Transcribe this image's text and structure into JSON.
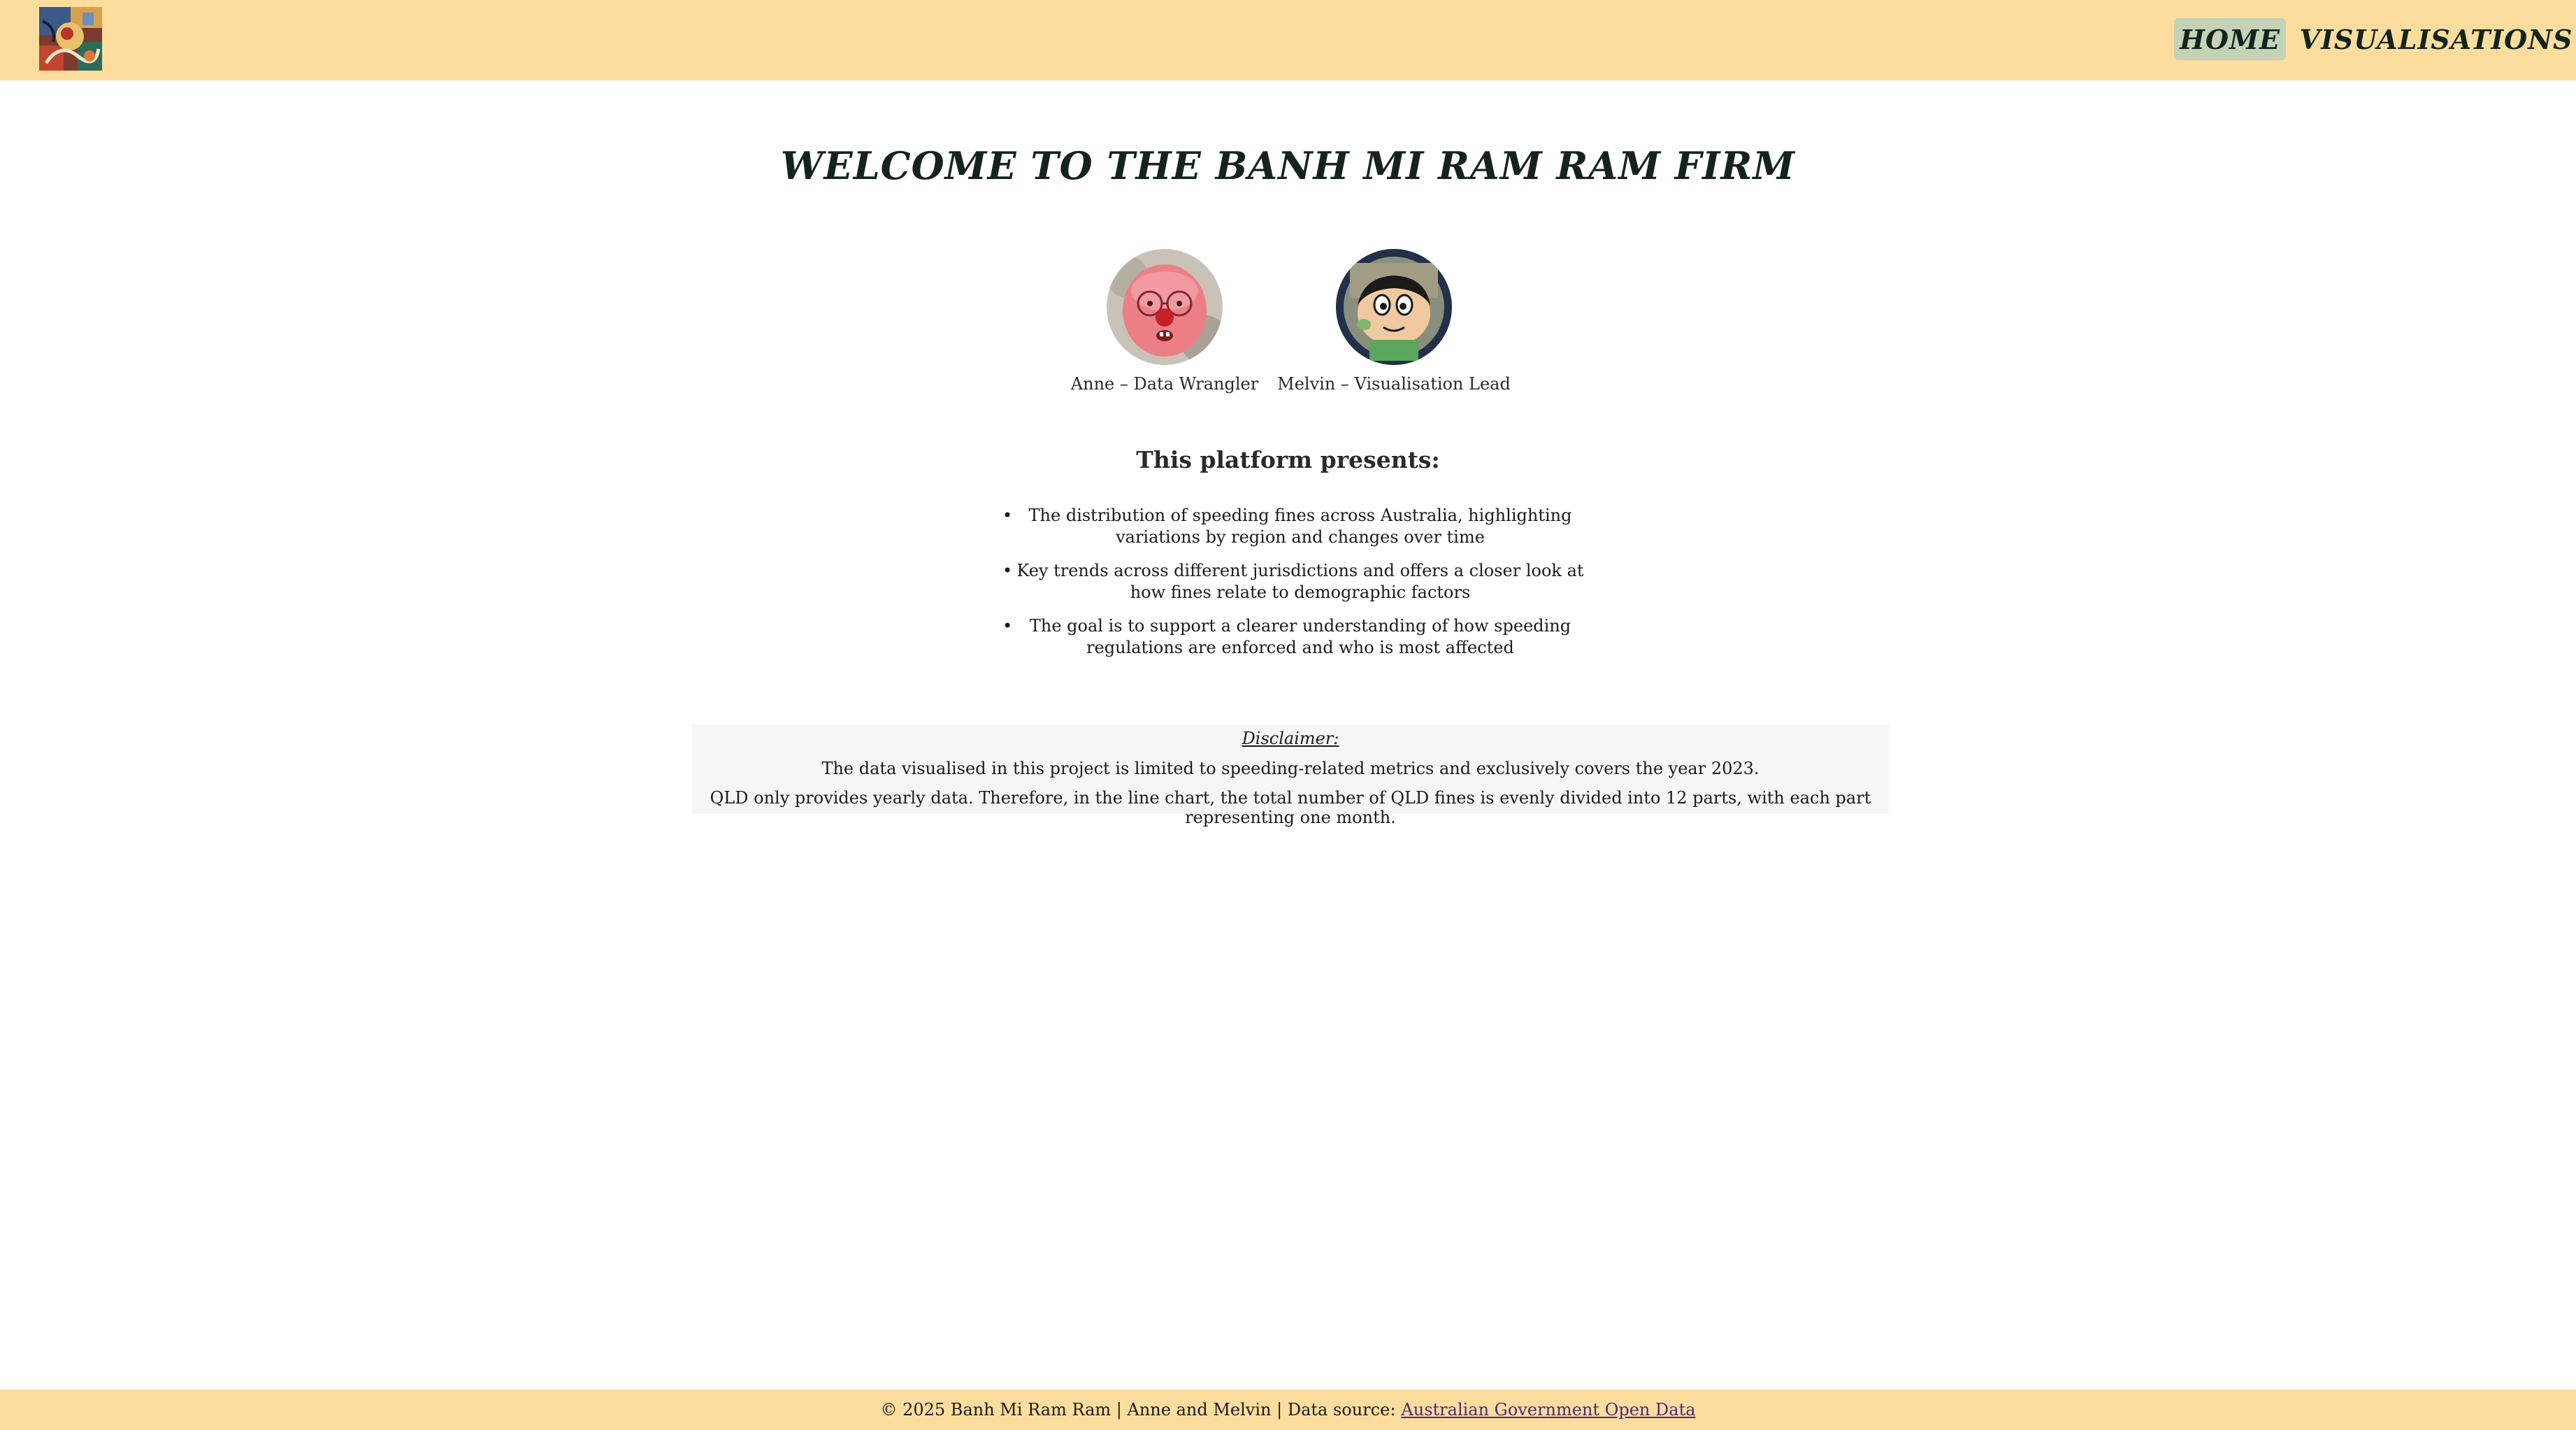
{
  "header": {
    "logo_icon": "abstract-art-logo-icon",
    "nav": {
      "home_label": "HOME",
      "visualisations_label": "VISUALISATIONS"
    }
  },
  "main": {
    "title": "WELCOME TO THE BANH MI RAM RAM FIRM",
    "team": [
      {
        "name": "Anne – Data Wrangler",
        "avatar_icon": "pink-glasses-character-icon"
      },
      {
        "name": "Melvin – Visualisation Lead",
        "avatar_icon": "cartoon-boy-character-icon"
      }
    ],
    "platform_heading": "This platform presents:",
    "bullets": [
      "The distribution of speeding fines across Australia, highlighting variations by region and changes over time",
      "Key trends across different jurisdictions and offers a closer look at how fines relate to demographic factors",
      "The goal is to support a clearer understanding of how speeding regulations are enforced and who is most affected"
    ]
  },
  "disclaimer": {
    "title": "Disclaimer:",
    "line1": "The data visualised in this project is limited to speeding-related metrics and exclusively covers the year 2023.",
    "line2": "QLD only provides yearly data. Therefore, in the line chart, the total number of QLD fines is evenly divided into 12 parts, with each part representing one month."
  },
  "footer": {
    "text": "© 2025 Banh Mi Ram Ram | Anne and Melvin | Data source:",
    "link_label": "Australian Government Open Data"
  },
  "colors": {
    "header_bg": "#fddd9e",
    "active_nav_bg": "#c4d2b8",
    "link": "#4a2a7a"
  }
}
